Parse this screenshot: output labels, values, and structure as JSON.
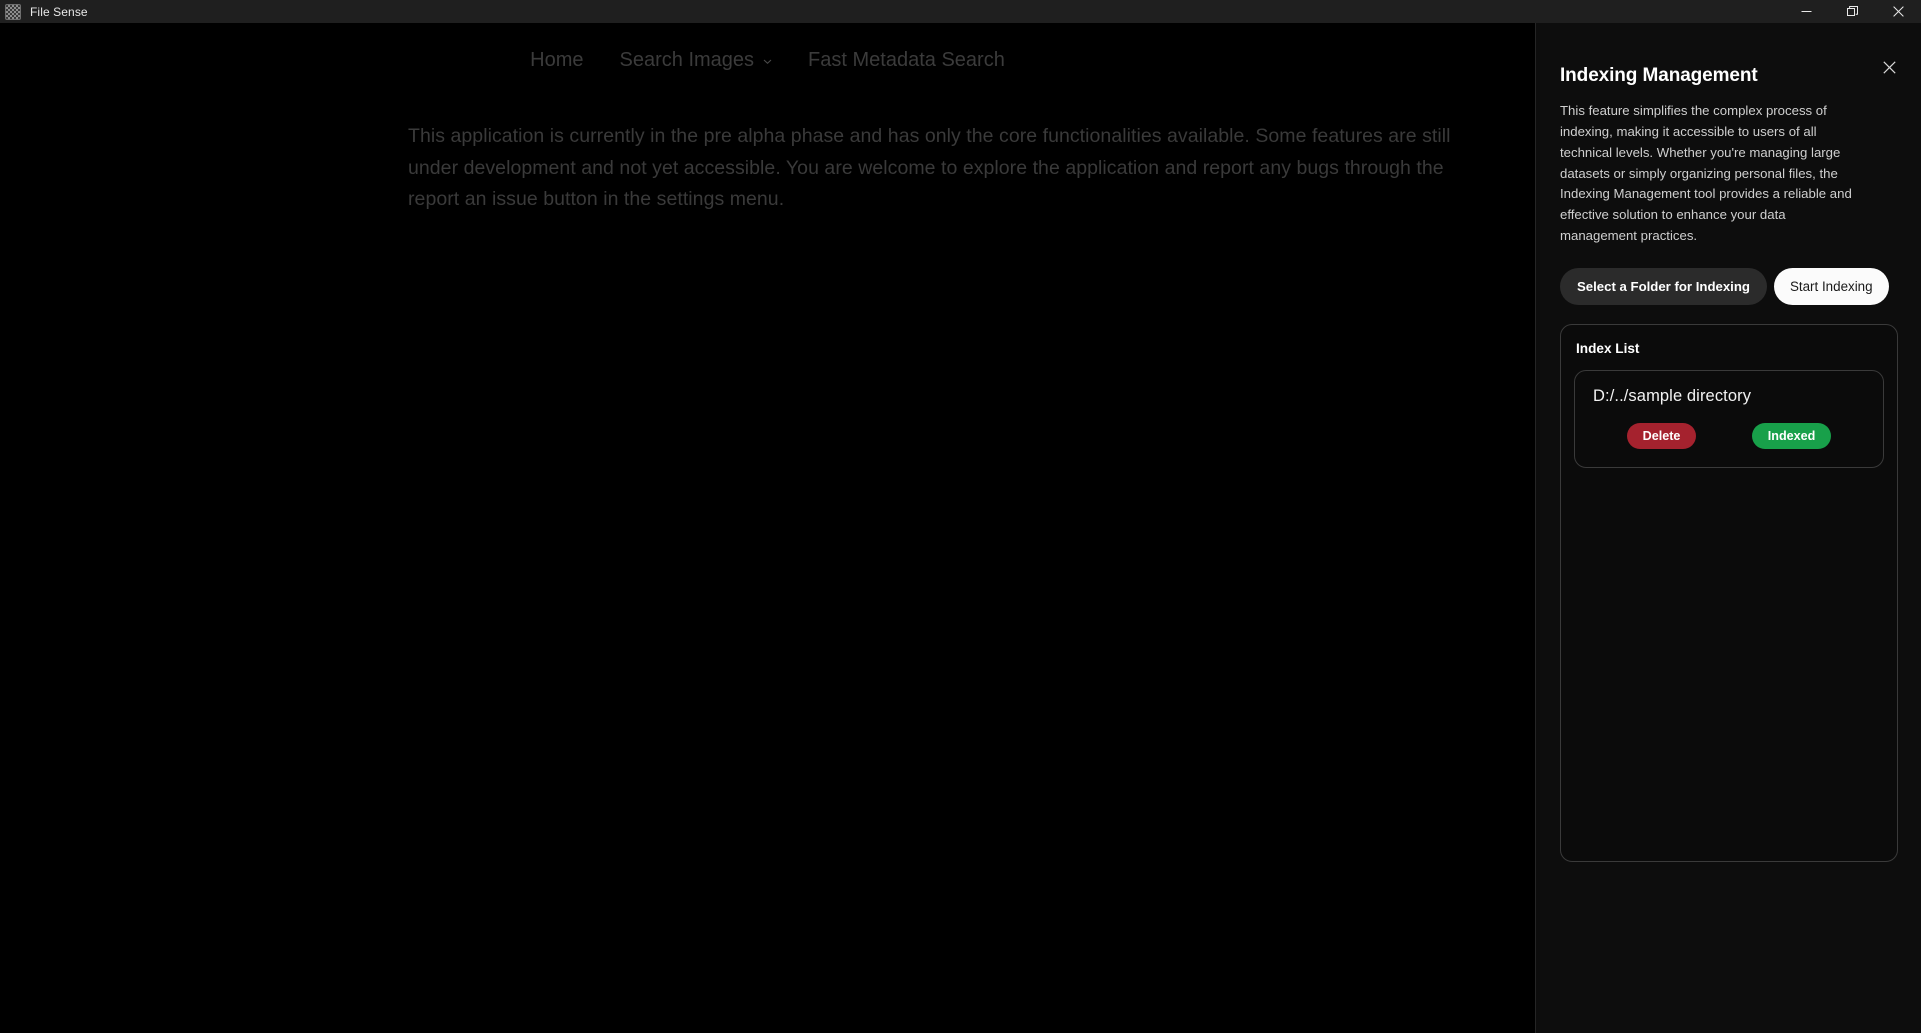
{
  "window": {
    "title": "File Sense",
    "icon": "app-icon",
    "controls": {
      "minimize": "minimize-icon",
      "restore": "restore-icon",
      "close": "close-icon"
    }
  },
  "nav": {
    "items": [
      {
        "label": "Home",
        "has_caret": false
      },
      {
        "label": "Search Images",
        "has_caret": true
      },
      {
        "label": "Fast Metadata Search",
        "has_caret": false
      }
    ]
  },
  "main": {
    "intro": "This application is currently in the pre alpha phase and has only the core functionalities available. Some features are still under development and not yet accessible. You are welcome to explore the application and report any bugs through the report an issue button in the settings menu."
  },
  "panel": {
    "title": "Indexing Management",
    "close_icon": "close-icon",
    "description": "This feature simplifies the complex process of indexing, making it accessible to users of all technical levels. Whether you're managing large datasets or simply organizing personal files, the Indexing Management tool provides a reliable and effective solution to enhance your data management practices.",
    "actions": {
      "select_folder_label": "Select a Folder for Indexing",
      "start_indexing_label": "Start Indexing"
    },
    "index_list": {
      "title": "Index List",
      "items": [
        {
          "path": "D:/../sample directory",
          "delete_label": "Delete",
          "status_label": "Indexed"
        }
      ]
    }
  },
  "colors": {
    "app_background": "#000000",
    "titlebar_background": "#1f1f1f",
    "panel_background": "#0d0d0d",
    "delete_red": "#a5222e",
    "indexed_green": "#18a04a",
    "start_indexing_white": "#fbfbfb"
  }
}
